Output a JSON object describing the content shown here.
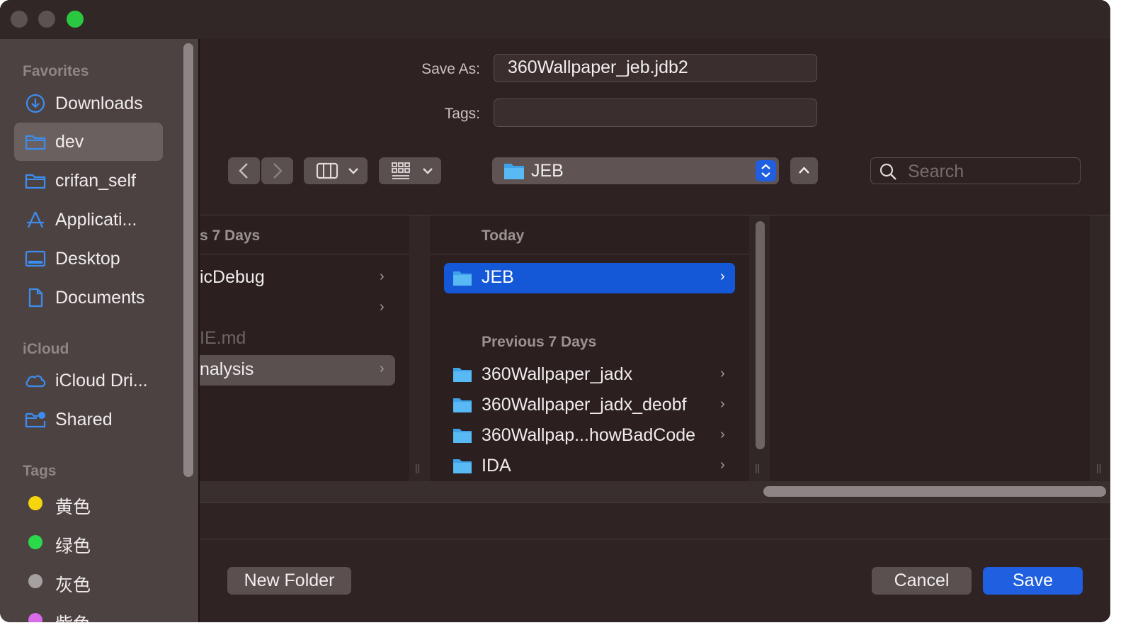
{
  "sidebar": {
    "sections": {
      "favorites": "Favorites",
      "icloud": "iCloud",
      "tags": "Tags"
    },
    "favorites": [
      {
        "label": "Downloads",
        "icon": "download-circle-icon"
      },
      {
        "label": "dev",
        "icon": "folder-icon",
        "selected": true
      },
      {
        "label": "crifan_self",
        "icon": "folder-icon"
      },
      {
        "label": "Applicati...",
        "icon": "applications-icon"
      },
      {
        "label": "Desktop",
        "icon": "desktop-icon"
      },
      {
        "label": "Documents",
        "icon": "document-icon"
      }
    ],
    "icloud": [
      {
        "label": "iCloud Dri...",
        "icon": "cloud-icon"
      },
      {
        "label": "Shared",
        "icon": "shared-folder-icon"
      }
    ],
    "tags": [
      {
        "label": "黄色",
        "color": "#f5d60e"
      },
      {
        "label": "绿色",
        "color": "#2bd94b"
      },
      {
        "label": "灰色",
        "color": "#a6a0a0"
      },
      {
        "label": "紫色",
        "color": "#d86be8"
      }
    ]
  },
  "form": {
    "save_as_label": "Save As:",
    "save_as_value": "360Wallpaper_jeb.jdb2",
    "tags_label": "Tags:",
    "tags_value": ""
  },
  "toolbar": {
    "location": "JEB",
    "search_placeholder": "Search"
  },
  "columns": {
    "left": {
      "header": "s 7 Days",
      "items": [
        {
          "label": "icDebug",
          "chevron": true
        },
        {
          "label": "",
          "chevron": true
        },
        {
          "label": "IE.md",
          "chevron": false,
          "dim": true
        },
        {
          "label": "nalysis",
          "chevron": true,
          "selected": true
        }
      ]
    },
    "middle": {
      "today_header": "Today",
      "today_items": [
        {
          "label": "JEB",
          "selected": true
        }
      ],
      "prev_header": "Previous 7 Days",
      "prev_items": [
        {
          "label": "360Wallpaper_jadx"
        },
        {
          "label": "360Wallpaper_jadx_deobf"
        },
        {
          "label": "360Wallpap...howBadCode"
        },
        {
          "label": "IDA"
        }
      ]
    }
  },
  "buttons": {
    "new_folder": "New Folder",
    "cancel": "Cancel",
    "save": "Save"
  },
  "colors": {
    "accent": "#1f5fe0",
    "selection": "#1458d8"
  }
}
